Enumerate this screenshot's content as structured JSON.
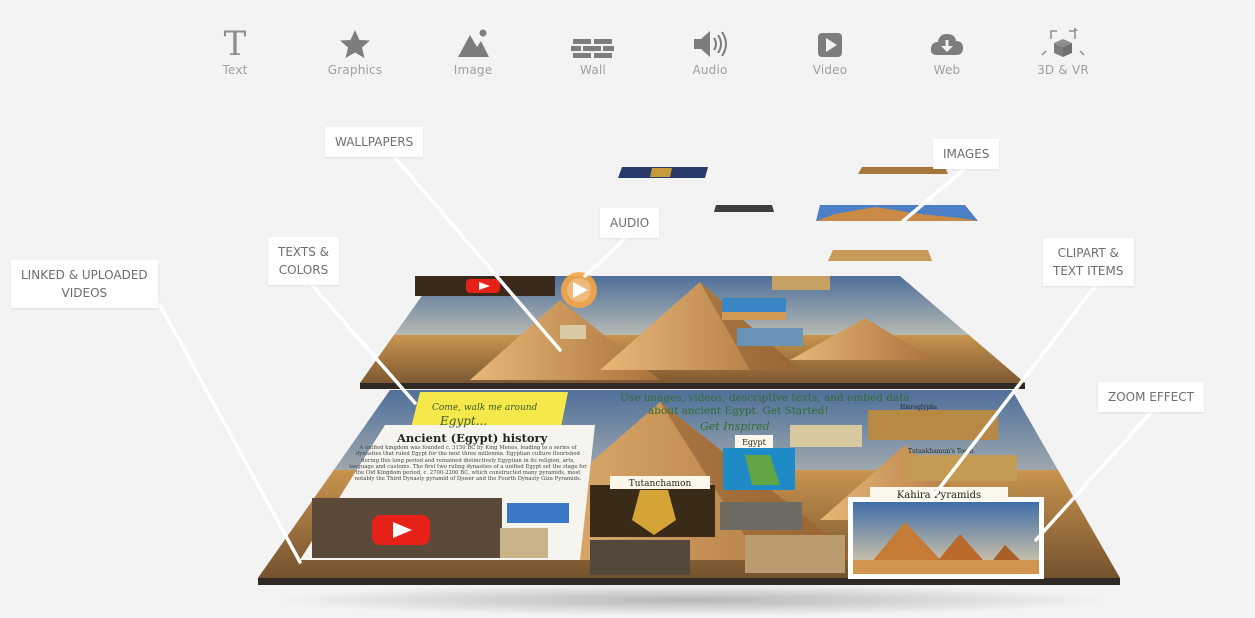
{
  "toolbar": {
    "items": [
      {
        "label": "Text",
        "icon": "text-icon"
      },
      {
        "label": "Graphics",
        "icon": "star-icon"
      },
      {
        "label": "Image",
        "icon": "image-icon"
      },
      {
        "label": "Wall",
        "icon": "brick-wall-icon"
      },
      {
        "label": "Audio",
        "icon": "speaker-icon"
      },
      {
        "label": "Video",
        "icon": "play-icon"
      },
      {
        "label": "Web",
        "icon": "cloud-download-icon"
      },
      {
        "label": "3D & VR",
        "icon": "cube-icon"
      }
    ]
  },
  "callouts": {
    "wallpapers": "WALLPAPERS",
    "images": "IMAGES",
    "audio": "AUDIO",
    "texts_line1": "TEXTS &",
    "texts_line2": "COLORS",
    "linked_line1": "LINKED & UPLOADED",
    "linked_line2": "VIDEOS",
    "clipart_line1": "CLIPART &",
    "clipart_line2": "TEXT ITEMS",
    "zoom": "ZOOM EFFECT"
  },
  "board": {
    "headline_line1": "Use images, videos, descriptive texts, and embed data",
    "headline_line2": "about ancient Egypt. Get Started!",
    "handwriting": "Get Inspired",
    "sticky_line1": "Come, walk me around",
    "sticky_line2": "Egypt...",
    "article_title": "Ancient (Egypt) history",
    "article_body": "A unified kingdom was founded c. 3150 BC by King Menes, leading to a series of dynasties that ruled Egypt for the next three millennia. Egyptian culture flourished during this long period and remained distinctively Egyptian in its religion, arts, language and customs. The first two ruling dynasties of a unified Egypt set the stage for the Old Kingdom period, c. 2700-2200 BC, which constructed many pyramids, most notably the Third Dynasty pyramid of Djoser and the Fourth Dynasty Giza Pyramids.",
    "label_egypt": "Egypt",
    "label_tut": "Tutanchamon",
    "label_kahira": "Kahira Pyramids",
    "label_small1": "Hieroglyphs",
    "label_small2": "Tutankhamun's Tomb"
  }
}
